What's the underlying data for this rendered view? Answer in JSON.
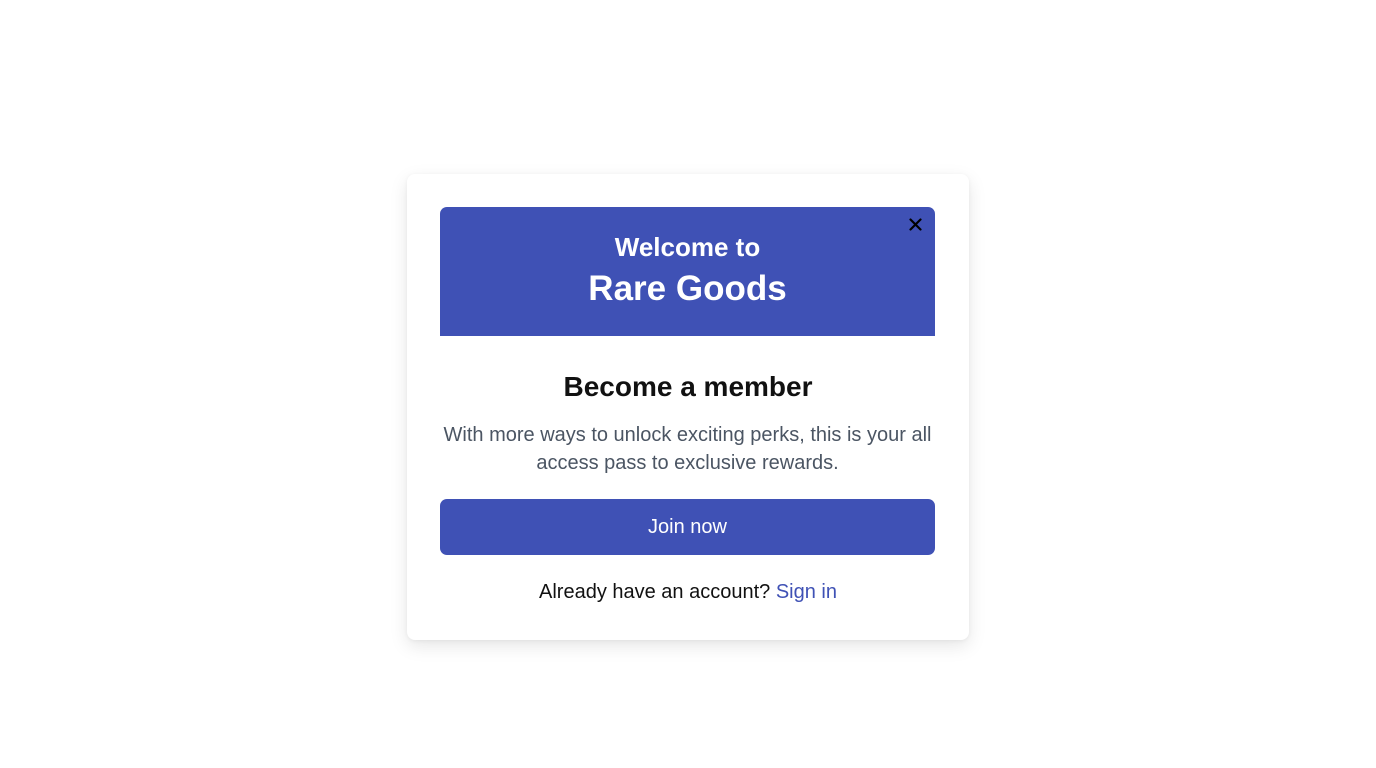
{
  "modal": {
    "banner": {
      "line1": "Welcome to",
      "line2": "Rare Goods",
      "close_icon": "close-icon",
      "background": "#3f51b5"
    },
    "title": "Become a member",
    "description": "With more ways to unlock exciting perks, this is your all access pass to exclusive rewards.",
    "join_button_label": "Join now",
    "signin_prompt": "Already have an account?",
    "signin_link": "Sign in",
    "accent_color": "#3f51b5"
  }
}
